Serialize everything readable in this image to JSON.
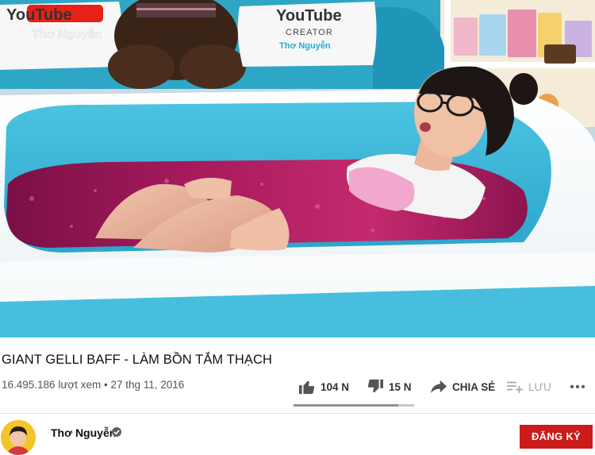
{
  "video": {
    "title": "GIANT GELLI BAFF - LÀM BỒN TẮM THẠCH",
    "views": "16.495.186 lượt xem",
    "separator": "•",
    "date": "27 thg 11, 2016",
    "like_ratio": 0.87
  },
  "thumbnail": {
    "pillow_left": {
      "brand": "YouTube",
      "creator": "Thơ Nguyễn"
    },
    "pillow_right": {
      "brand": "YouTube",
      "subtitle": "CREATOR",
      "creator": "Thơ Nguyễn"
    }
  },
  "actions": {
    "like_count": "104 N",
    "dislike_count": "15 N",
    "share_label": "CHIA SẺ",
    "save_label": "LƯU",
    "more_icon": "more-horizontal-icon"
  },
  "channel": {
    "name": "Thơ Nguyễn",
    "verified_icon": "verified-check-icon",
    "subscribe_label": "ĐĂNG KÝ"
  },
  "colors": {
    "subscribe": "#cc1b1b",
    "jelly": "#a0185e",
    "tub_blue": "#3fb7d8"
  }
}
